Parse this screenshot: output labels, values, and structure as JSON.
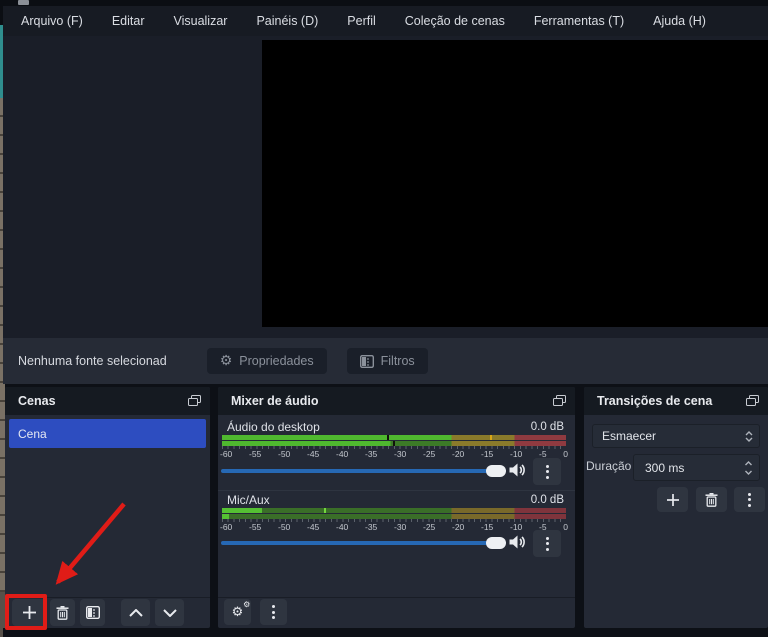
{
  "menubar": {
    "items": [
      "Arquivo (F)",
      "Editar",
      "Visualizar",
      "Painéis (D)",
      "Perfil",
      "Coleção de cenas",
      "Ferramentas (T)",
      "Ajuda (H)"
    ]
  },
  "source_toolbar": {
    "status_text": "Nenhuma fonte selecionad",
    "properties_button": "Propriedades",
    "filters_button": "Filtros",
    "gear_glyph": "⚙"
  },
  "scenes_panel": {
    "title": "Cenas",
    "scenes": [
      {
        "name": "Cena"
      }
    ]
  },
  "mixer_panel": {
    "title": "Mixer de áudio",
    "ticks": [
      "-60",
      "-55",
      "-50",
      "-45",
      "-40",
      "-35",
      "-30",
      "-25",
      "-20",
      "-15",
      "-10",
      "-5",
      "0"
    ],
    "channels": [
      {
        "name": "Áudio do desktop",
        "level": "0.0 dB",
        "rows": [
          {
            "segments": [
              {
                "color": "#4fb82f",
                "from": 0,
                "to": 0.667
              },
              {
                "color": "#8a7a2b",
                "from": 0.667,
                "to": 0.85
              },
              {
                "color": "#8f3a40",
                "from": 0.85,
                "to": 1
              }
            ],
            "peaks": [
              {
                "color": "#10130a",
                "pos": 0.483
              },
              {
                "color": "#d9a616",
                "pos": 0.783
              }
            ]
          },
          {
            "segments": [
              {
                "color": "#4fb82f",
                "from": 0,
                "to": 0.49
              },
              {
                "color": "#3c7a27",
                "from": 0.49,
                "to": 0.667
              },
              {
                "color": "#8a7a2b",
                "from": 0.667,
                "to": 0.85
              },
              {
                "color": "#8f3a40",
                "from": 0.85,
                "to": 1
              }
            ],
            "peaks": [
              {
                "color": "#10130a",
                "pos": 0.5
              }
            ]
          }
        ]
      },
      {
        "name": "Mic/Aux",
        "level": "0.0 dB",
        "rows": [
          {
            "segments": [
              {
                "color": "#55c133",
                "from": 0,
                "to": 0.117
              },
              {
                "color": "#3a6e28",
                "from": 0.117,
                "to": 0.667
              },
              {
                "color": "#79692a",
                "from": 0.667,
                "to": 0.85
              },
              {
                "color": "#7f343c",
                "from": 0.85,
                "to": 1
              }
            ],
            "peaks": [
              {
                "color": "#74d73f",
                "pos": 0.3
              }
            ]
          },
          {
            "segments": [
              {
                "color": "#55c133",
                "from": 0,
                "to": 0.02
              },
              {
                "color": "#3a6e28",
                "from": 0.02,
                "to": 0.667
              },
              {
                "color": "#79692a",
                "from": 0.667,
                "to": 0.85
              },
              {
                "color": "#7f343c",
                "from": 0.85,
                "to": 1
              }
            ],
            "peaks": []
          }
        ]
      }
    ]
  },
  "transitions_panel": {
    "title": "Transições de cena",
    "transition_selected": "Esmaecer",
    "duration_label": "Duração",
    "duration_value": "300 ms"
  },
  "colors": {
    "scene_selected_blue": "#2d4dc0",
    "slider_blue": "#2668b4",
    "annotation_red": "#e01c17"
  }
}
